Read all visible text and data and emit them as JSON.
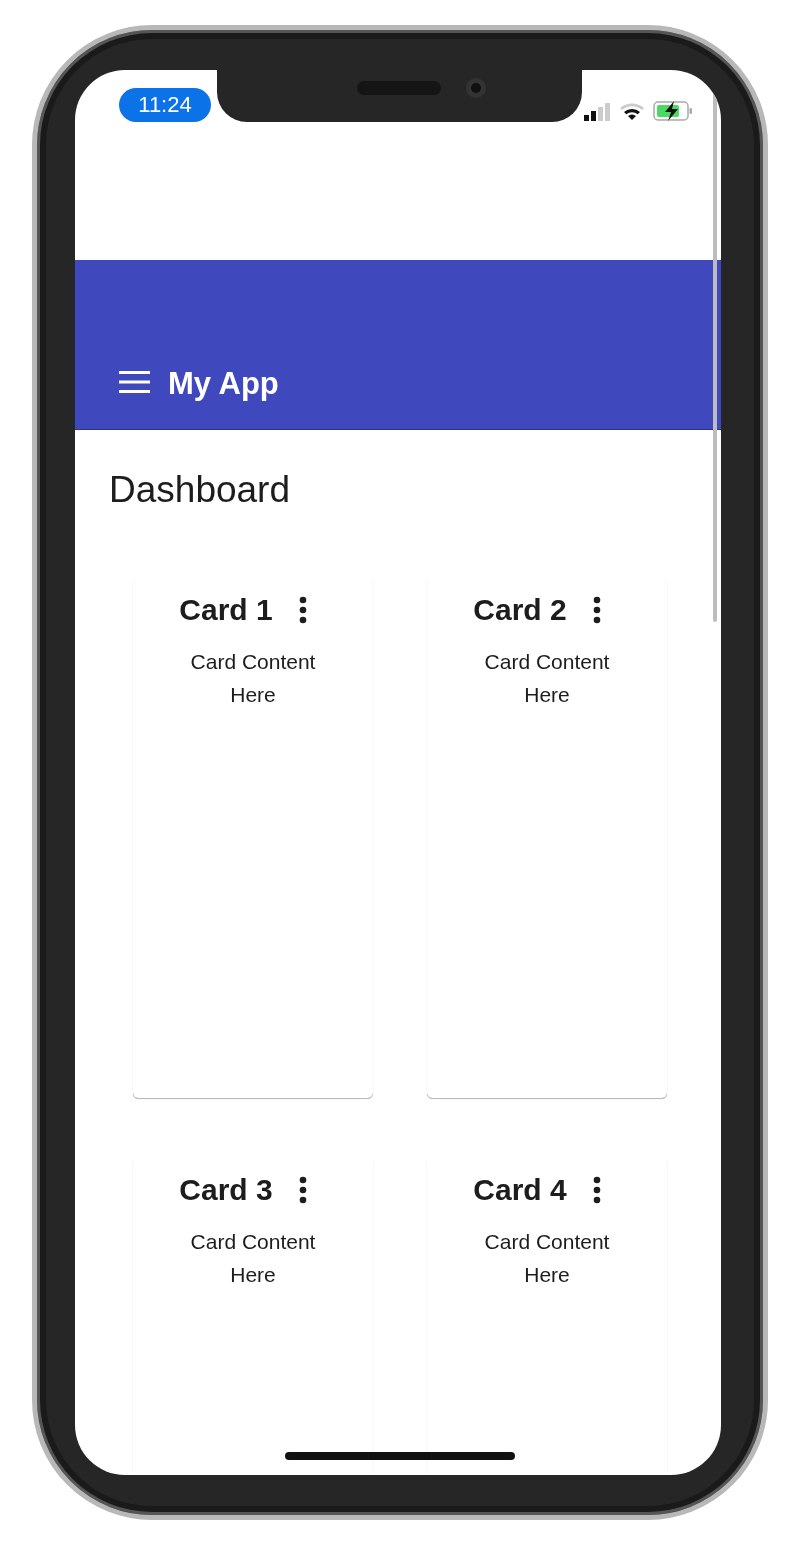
{
  "status_bar": {
    "time": "11:24"
  },
  "app_bar": {
    "title": "My App"
  },
  "page_title": "Dashboard",
  "cards": [
    {
      "title": "Card 1",
      "content": "Card Content Here"
    },
    {
      "title": "Card 2",
      "content": "Card Content Here"
    },
    {
      "title": "Card 3",
      "content": "Card Content Here"
    },
    {
      "title": "Card 4",
      "content": "Card Content Here"
    }
  ]
}
